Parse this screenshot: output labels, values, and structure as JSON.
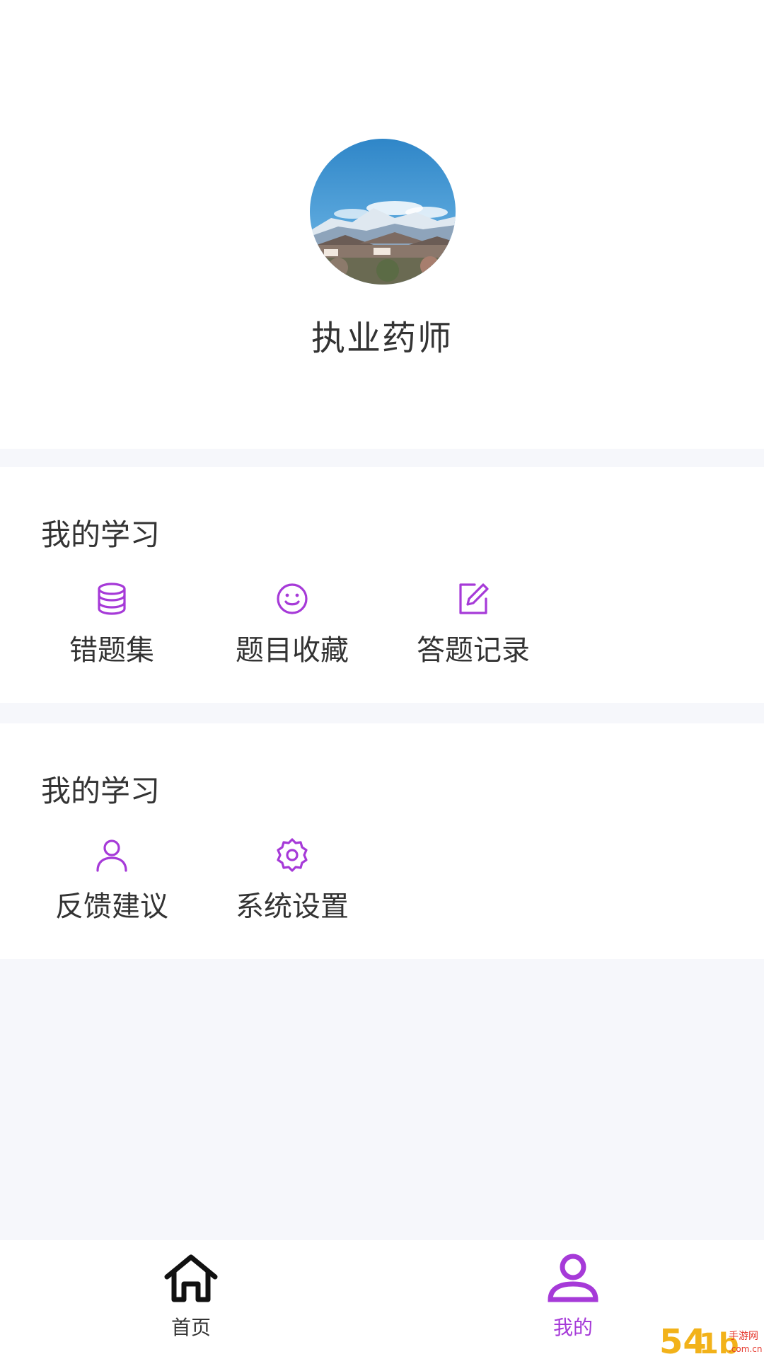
{
  "colors": {
    "accent": "#a63ad8",
    "text": "#333333",
    "background": "#f6f7fb",
    "card": "#ffffff"
  },
  "profile": {
    "name": "执业药师"
  },
  "sections": [
    {
      "title": "我的学习",
      "items": [
        {
          "label": "错题集",
          "icon": "database-icon"
        },
        {
          "label": "题目收藏",
          "icon": "smile-icon"
        },
        {
          "label": "答题记录",
          "icon": "edit-icon"
        }
      ]
    },
    {
      "title": "我的学习",
      "items": [
        {
          "label": "反馈建议",
          "icon": "user-icon"
        },
        {
          "label": "系统设置",
          "icon": "gear-icon"
        }
      ]
    }
  ],
  "tabbar": {
    "items": [
      {
        "label": "首页",
        "icon": "home-icon",
        "active": false
      },
      {
        "label": "我的",
        "icon": "user-icon",
        "active": true
      }
    ]
  }
}
